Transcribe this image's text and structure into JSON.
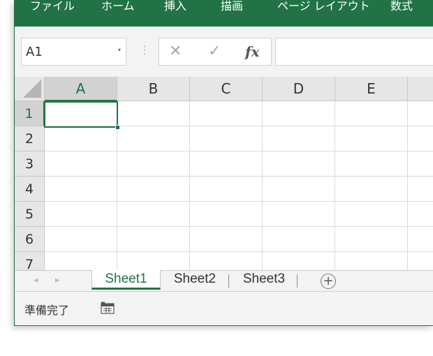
{
  "ribbon": {
    "tabs": [
      "ファイル",
      "ホーム",
      "挿入",
      "描画",
      "ページ レイアウト",
      "数式"
    ]
  },
  "formula_bar": {
    "name_box": "A1",
    "name_box_caret": "▾",
    "separator": "⋮",
    "cancel_glyph": "✕",
    "enter_glyph": "✓",
    "fx_label": "fx",
    "formula_value": ""
  },
  "grid": {
    "columns": [
      "A",
      "B",
      "C",
      "D",
      "E"
    ],
    "rows": [
      "1",
      "2",
      "3",
      "4",
      "5",
      "6",
      "7"
    ],
    "active_cell": "A1"
  },
  "sheets": {
    "tabs": [
      "Sheet1",
      "Sheet2",
      "Sheet3"
    ],
    "active": "Sheet1",
    "prev_glyph": "◂",
    "next_glyph": "▸",
    "add_glyph": "+"
  },
  "status": {
    "text": "準備完了",
    "icon": "cell-mode-icon"
  },
  "colors": {
    "brand_green": "#217346",
    "header_gray": "#e6e6e6",
    "gridline": "#dadada"
  }
}
